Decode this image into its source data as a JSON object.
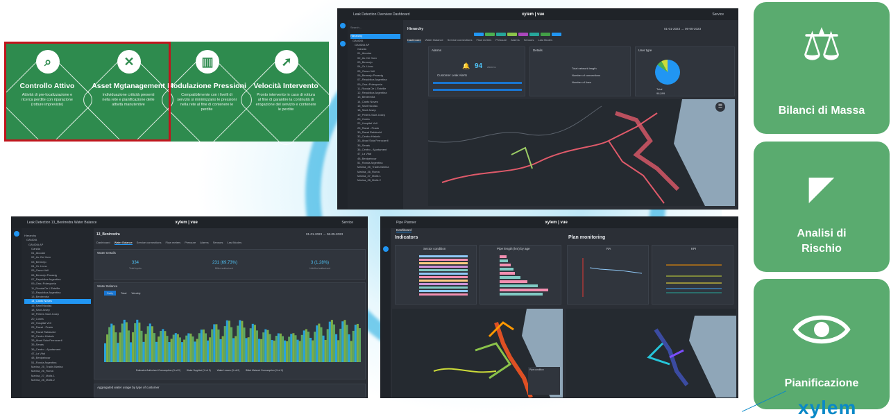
{
  "features": [
    {
      "title": "Controllo Attivo",
      "desc": "Attività di pre-localizzazione e ricerca perdite con riparazione (rotture impreviste)",
      "icon": "search-icon",
      "glyph": "⌕"
    },
    {
      "title": "Asset Mgtanagement",
      "desc": "Individuazione criticità presenti nella rete e pianificazione delle attività manutentive",
      "icon": "tools-icon",
      "glyph": "✕"
    },
    {
      "title": "Modulazione Pressioni",
      "desc": "Compatibilmente con i livelli di servizio si minimizzano le pressioni nella rete al fine di contenere le perdite",
      "icon": "bar-chart-icon",
      "glyph": "▥"
    },
    {
      "title": "Velocità Intervento",
      "desc": "Pronto intervento in caso di rottura al fine di garantire la continuità di erogazione del servizio e contenere le perdite",
      "icon": "runner-icon",
      "glyph": "➚"
    }
  ],
  "tiles": [
    {
      "label": "Bilanci di Massa",
      "icon": "scale-icon"
    },
    {
      "label": "Analisi di Rischio",
      "icon": "camera-icon"
    },
    {
      "label": "Pianificazione",
      "icon": "eye-icon"
    }
  ],
  "brand": "xylem",
  "app1": {
    "nav": "Leak Detection   Overview   Dashboard",
    "logo": "xylem | vue",
    "user": "Service",
    "search": "Search...",
    "hierarchy_title": "Hierarchy",
    "date_from": "01-01-2023",
    "date_to": "06-05-2023",
    "tabs": [
      "Dashboard",
      "Water Balance",
      "Service connections",
      "Flow meters",
      "Pressure",
      "Alarms",
      "Sensors",
      "Last Modes"
    ],
    "alarms_title": "Alarms",
    "alarms_count": "94",
    "alarms_unit": "Alarms",
    "leak_alerts": "Customer Leak Alerts",
    "details_title": "Details",
    "details": [
      "Total network length",
      "Number of connections",
      "Number of lines"
    ],
    "user_type_title": "User type",
    "total_label": "Total",
    "total_value": "96,599",
    "tree_items": [
      "Hierarchy",
      "GANDIA",
      "GANDIA AP",
      "Gandia",
      "01_Alcodar",
      "02_Av. De Xuro",
      "03_Bermejo",
      "04_Gr. Llonc",
      "05_Gravo Vell",
      "06_Bermejo Passeig",
      "07_Republica Argentina",
      "09_Grau Polesporta",
      "11_Ronda De L'Estellle",
      "12_Republica Argentina",
      "13_Benirredra",
      "14_Canto Noves",
      "15_Sant Nicolau",
      "18_Sant Josep",
      "19_Pellers Sant Josep",
      "20_Corea",
      "22_Hospital Vell",
      "25_Raval - Prado",
      "30_Raval Rafalcaïd",
      "32_Centro Historic",
      "33_Abad Sola Ferrocarril",
      "35_Serals",
      "36_Centro - Ajuntament",
      "47_La Vital",
      "48_Benipeixcar",
      "51_Ronda Argentina",
      "Marina_25_Tradis Marina",
      "Marina_26_Roma",
      "Marina_27_Molls 1",
      "Marina_28_Molls 2"
    ]
  },
  "app2": {
    "nav": "Leak Detection   13_Benirredra   Water Balance",
    "logo": "xylem | vue",
    "user": "Service",
    "page_title": "13_Benirredra",
    "tabs": [
      "Dashboard",
      "Water Balance",
      "Service connections",
      "Flow meters",
      "Pressure",
      "Alarms",
      "Sensors",
      "Last Modes"
    ],
    "water_details": "Water Details",
    "stats": [
      {
        "value": "334",
        "label": "Total Inputs"
      },
      {
        "value": "231 (69.73%)",
        "label": "Billed authorized"
      },
      {
        "value": "3 (1.28%)",
        "label": "Unbilled authorized"
      }
    ],
    "water_balance": "Water Balance",
    "chart_tabs": [
      "Daily",
      "Total",
      "Weekly"
    ],
    "legend": [
      "Estimated Authorized Consumption (% of 0)",
      "Water Supplied (% of 0)",
      "Water Losses (% of 0)",
      "Billed Metered Consumption (% of 0)"
    ],
    "aggregated": "Aggregated water usage by type of customer",
    "date_from": "01-01-2023",
    "date_to": "06-05-2023"
  },
  "app3": {
    "nav": "Pipe Planner",
    "logo": "xylem | vue",
    "dashboard": "Dashboard",
    "indicators": "Indicators",
    "plan_monitoring": "Plan monitoring",
    "chart1": "Sector condition",
    "chart2": "Pipe length (km) by age",
    "chart3": "RA",
    "chart4": "KPI",
    "legend_title": "Pipe condition"
  }
}
